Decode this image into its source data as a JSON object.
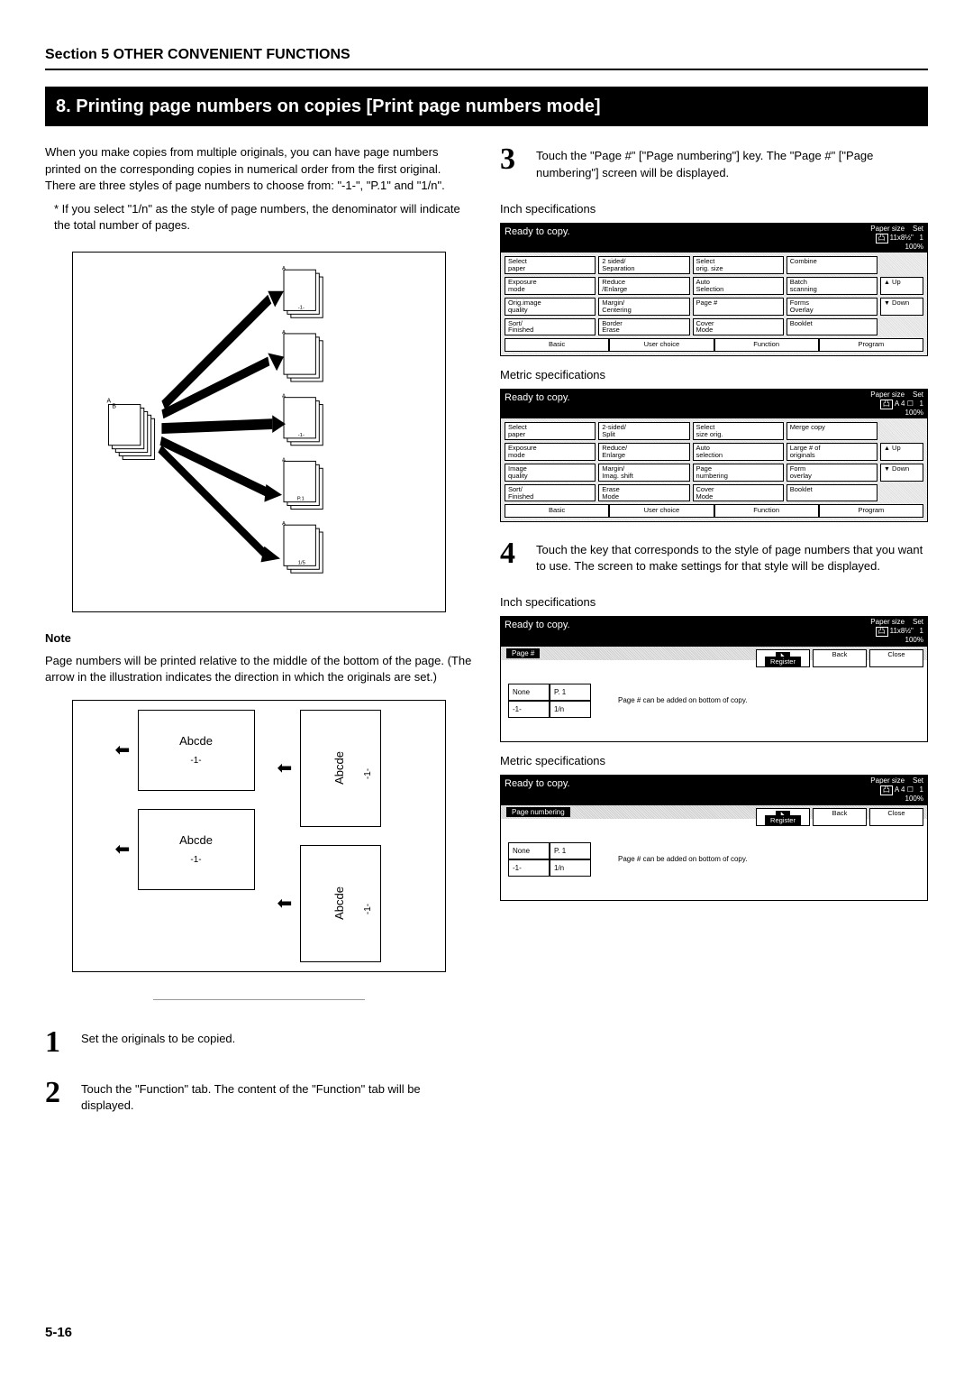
{
  "section_header": "Section 5  OTHER CONVENIENT FUNCTIONS",
  "title": "8.   Printing page numbers on copies [Print page numbers mode]",
  "intro_p1": "When you make copies from multiple originals, you can have page numbers printed on the corresponding copies in numerical order from the first original. There are three styles of page numbers to choose from: \"-1-\", \"P.1\" and \"1/n\".",
  "intro_p2": "* If you select \"1/n\" as the style of page numbers, the denominator will indicate the total number of pages.",
  "note_label": "Note",
  "note_text": "Page numbers will be printed relative to the middle of the bottom of the page. (The arrow in the illustration indicates the direction in which the originals are set.)",
  "abcde": "Abcde",
  "pgnum1": "-1-",
  "step1_num": "1",
  "step1_text": "Set the originals to be copied.",
  "step2_num": "2",
  "step2_text": "Touch the \"Function\" tab. The content of the \"Function\" tab will be displayed.",
  "step3_num": "3",
  "step3_text": "Touch the \"Page #\" [\"Page numbering\"] key. The \"Page #\" [\"Page numbering\"] screen will be displayed.",
  "step4_num": "4",
  "step4_text": "Touch the key that corresponds to the style of page numbers that you want to use. The screen to make settings for that style will be displayed.",
  "inch_spec": "Inch specifications",
  "metric_spec": "Metric specifications",
  "ready": "Ready to copy.",
  "paper_size": "Paper size",
  "set": "Set",
  "pct100": "100%",
  "num1": "1",
  "ps_inch": "11x8½\"",
  "ps_metric": "A 4",
  "inch_grid": {
    "r1": [
      "Select\npaper",
      "2 sided/\nSeparation",
      "Select\norig. size",
      "Combine"
    ],
    "r2": [
      "Exposure\nmode",
      "Reduce\n/Enlarge",
      "Auto\nSelection",
      "Batch\nscanning"
    ],
    "r3": [
      "Orig.image\nquality",
      "Margin/\nCentering",
      "Page #",
      "Forms\nOverlay"
    ],
    "r4": [
      "Sort/\nFinished",
      "Border\nErase",
      "Cover\nMode",
      "Booklet"
    ],
    "up": "Up",
    "down": "Down"
  },
  "metric_grid": {
    "r1": [
      "Select\npaper",
      "2-sided/\nSplit",
      "Select\nsize orig.",
      "Merge copy"
    ],
    "r2": [
      "Exposure\nmode",
      "Reduce/\nEnlarge",
      "Auto\nselection",
      "Large # of\noriginals"
    ],
    "r3": [
      "Image\nquality",
      "Margin/\nImag. shift",
      "Page\nnumbering",
      "Form\noverlay"
    ],
    "r4": [
      "Sort/\nFinished",
      "Erase\nMode",
      "Cover\nMode",
      "Booklet"
    ],
    "up": "Up",
    "down": "Down"
  },
  "tabs": [
    "Basic",
    "User choice",
    "Function",
    "Program"
  ],
  "register": "Register",
  "back": "Back",
  "close": "Close",
  "crumb_inch": "Page #",
  "crumb_metric": "Page numbering",
  "style_btns": [
    "None",
    "P. 1",
    "-1-",
    "1/n"
  ],
  "style_note": "Page # can be added on bottom of copy.",
  "footer": "5-16"
}
